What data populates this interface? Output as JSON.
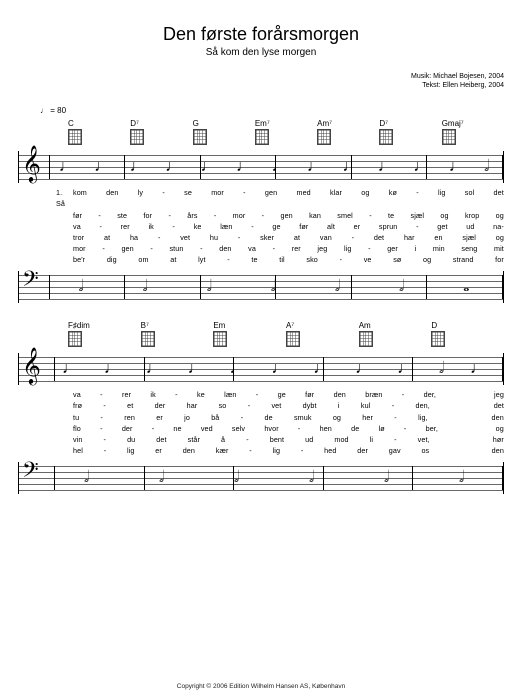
{
  "title": "Den første forårsmorgen",
  "subtitle": "Så kom den lyse morgen",
  "credits": {
    "music": "Musik: Michael Bojesen, 2004",
    "text": "Tekst: Ellen Heiberg, 2004"
  },
  "tempo": "♩ = 80",
  "system1": {
    "chords": [
      "C",
      "D⁷",
      "G",
      "Em⁷",
      "Am⁷",
      "D⁷",
      "Gmaj⁷"
    ],
    "verse_label": "1. Så",
    "lyrics": [
      [
        "kom",
        "den",
        "ly",
        "-",
        "se",
        "mor",
        "-",
        "gen",
        "med",
        "klar",
        "og",
        "kø",
        "-",
        "lig",
        "sol",
        "det"
      ],
      [
        "før",
        "-",
        "ste",
        "for",
        "-",
        "års",
        "-",
        "mor",
        "-",
        "gen",
        "kan",
        "smel",
        "-",
        "te",
        "sjæl",
        "og",
        "krop",
        "og"
      ],
      [
        "va",
        "-",
        "rer",
        "ik",
        "-",
        "ke",
        "læn",
        "-",
        "ge",
        "før",
        "alt",
        "er",
        "sprun",
        "-",
        "get",
        "ud",
        "na-"
      ],
      [
        "tror",
        "at",
        "ha",
        "-",
        "vet",
        "hu",
        "-",
        "sker",
        "at",
        "van",
        "-",
        "det",
        "har",
        "en",
        "sjæl",
        "og"
      ],
      [
        "mor",
        "-",
        "gen",
        "-",
        "stun",
        "-",
        "den",
        "va",
        "-",
        "rer",
        "jeg",
        "lig",
        "-",
        "ger",
        "i",
        "min",
        "seng",
        "mit"
      ],
      [
        "be'r",
        "dig",
        "om",
        "at",
        "lyt",
        "-",
        "te",
        "til",
        "sko",
        "-",
        "ve",
        "sø",
        "og",
        "strand",
        "for"
      ]
    ]
  },
  "system2": {
    "chords": [
      "F♯dim",
      "B⁷",
      "Em",
      "A⁷",
      "Am",
      "D"
    ],
    "lyrics": [
      [
        "va",
        "-",
        "rer",
        "ik",
        "-",
        "ke",
        "læn",
        "-",
        "ge",
        "før",
        "den",
        "bræn",
        "-",
        "der,",
        "",
        "",
        "jeg"
      ],
      [
        "frø",
        "-",
        "et",
        "der",
        "har",
        "so",
        "-",
        "vet",
        "dybt",
        "i",
        "kul",
        "-",
        "den,",
        "",
        "",
        "det"
      ],
      [
        "tu",
        "-",
        "ren",
        "er",
        "jo",
        "bå",
        "-",
        "de",
        "smuk",
        "og",
        "her",
        "-",
        "lig,",
        "",
        "",
        "den"
      ],
      [
        "flo",
        "-",
        "der",
        "-",
        "ne",
        "ved",
        "selv",
        "hvor",
        "-",
        "hen",
        "de",
        "lø",
        "-",
        "ber,",
        "",
        "",
        "og"
      ],
      [
        "vin",
        "-",
        "du",
        "det",
        "står",
        "å",
        "-",
        "bent",
        "ud",
        "mod",
        "li",
        "-",
        "vet,",
        "",
        "",
        "hør"
      ],
      [
        "hel",
        "-",
        "lig",
        "er",
        "den",
        "kær",
        "-",
        "lig",
        "-",
        "hed",
        "der",
        "gav",
        "os",
        "",
        "",
        "den"
      ]
    ]
  },
  "copyright": "Copyright © 2006 Edition Wilhelm Hansen AS, København"
}
